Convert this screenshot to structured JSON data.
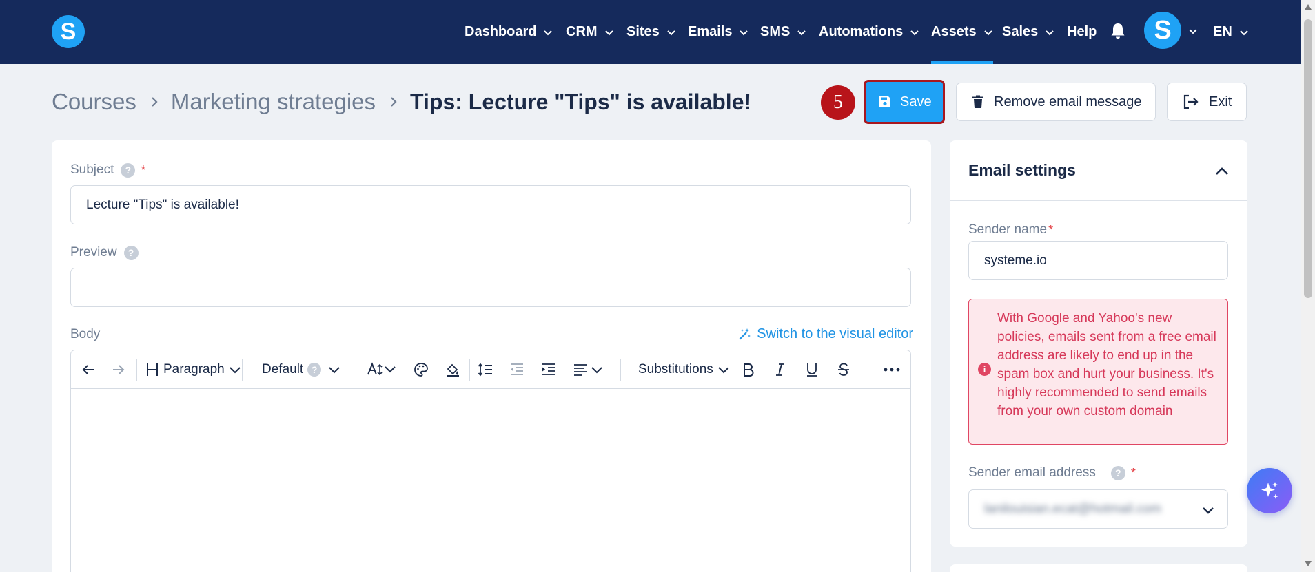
{
  "nav": {
    "logo_letter": "S",
    "items": [
      {
        "label": "Dashboard",
        "dropdown": true
      },
      {
        "label": "CRM",
        "dropdown": true
      },
      {
        "label": "Sites",
        "dropdown": true
      },
      {
        "label": "Emails",
        "dropdown": true
      },
      {
        "label": "SMS",
        "dropdown": true
      },
      {
        "label": "Automations",
        "dropdown": true
      },
      {
        "label": "Assets",
        "dropdown": true,
        "active": true
      },
      {
        "label": "Sales",
        "dropdown": true
      },
      {
        "label": "Help",
        "dropdown": false
      }
    ],
    "avatar_letter": "S",
    "language": "EN",
    "colors": {
      "background": "#152a5c",
      "accent": "#1fa2f5"
    }
  },
  "breadcrumb": {
    "items": [
      "Courses",
      "Marketing strategies"
    ],
    "current": "Tips: Lecture \"Tips\" is available!"
  },
  "step_badge": "5",
  "actions": {
    "save": "Save",
    "remove": "Remove email message",
    "exit": "Exit"
  },
  "form": {
    "subject_label": "Subject",
    "subject_value": "Lecture \"Tips\" is available!",
    "preview_label": "Preview",
    "preview_value": "",
    "body_label": "Body",
    "switch_editor": "Switch to the visual editor",
    "help_glyph": "?",
    "required_glyph": "*"
  },
  "toolbar": {
    "paragraph": "Paragraph",
    "font": "Default",
    "substitutions": "Substitutions",
    "icons": [
      "undo-icon",
      "redo-icon",
      "heading-icon",
      "font-size-icon",
      "text-color-icon",
      "highlight-icon",
      "line-height-icon",
      "outdent-icon",
      "indent-icon",
      "align-icon",
      "bold-icon",
      "italic-icon",
      "underline-icon",
      "strikethrough-icon",
      "more-icon"
    ]
  },
  "settings": {
    "title": "Email settings",
    "sender_name_label": "Sender name",
    "sender_name_value": "systeme.io",
    "warning_text": "With Google and Yahoo's new policies, emails sent from a free email address are likely to end up in the spam box and hurt your business. It's highly recommended to send emails from your own custom domain",
    "warning_icon": "i",
    "sender_email_label": "Sender email address",
    "sender_email_value": "lanilouisian.ecat@hotmail.com"
  },
  "colors": {
    "save_button": "#1fa2f5",
    "highlight_border": "#a81820",
    "warning_text": "#d63859",
    "warning_bg": "#fde8ec"
  }
}
